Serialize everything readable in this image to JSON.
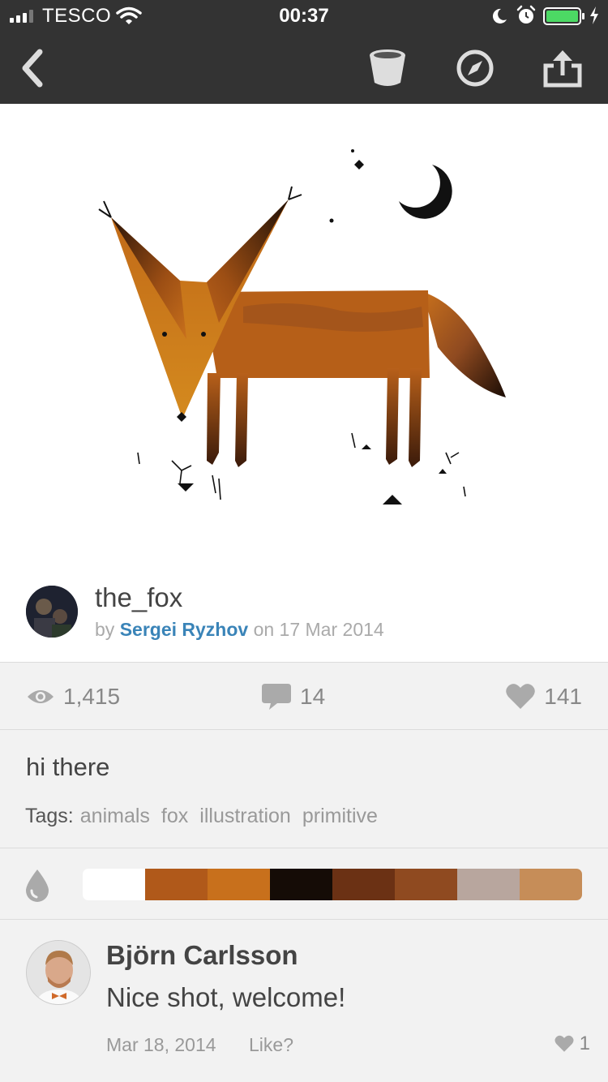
{
  "status_bar": {
    "carrier": "TESCO",
    "time": "00:37"
  },
  "shot": {
    "title": "the_fox",
    "by_prefix": "by",
    "author": "Sergei Ryzhov",
    "date_text": "on 17 Mar 2014"
  },
  "stats": {
    "views": "1,415",
    "comments": "14",
    "likes": "141"
  },
  "description": "hi there",
  "tags": {
    "label": "Tags:",
    "items": [
      "animals",
      "fox",
      "illustration",
      "primitive"
    ]
  },
  "palette": [
    "#ffffff",
    "#b0591a",
    "#c8701c",
    "#150c06",
    "#6b3114",
    "#8f4a20",
    "#b8a69e",
    "#c68d58"
  ],
  "comment": {
    "author": "Björn Carlsson",
    "text": "Nice shot, welcome!",
    "date": "Mar 18, 2014",
    "like_label": "Like?",
    "likes": "1"
  }
}
